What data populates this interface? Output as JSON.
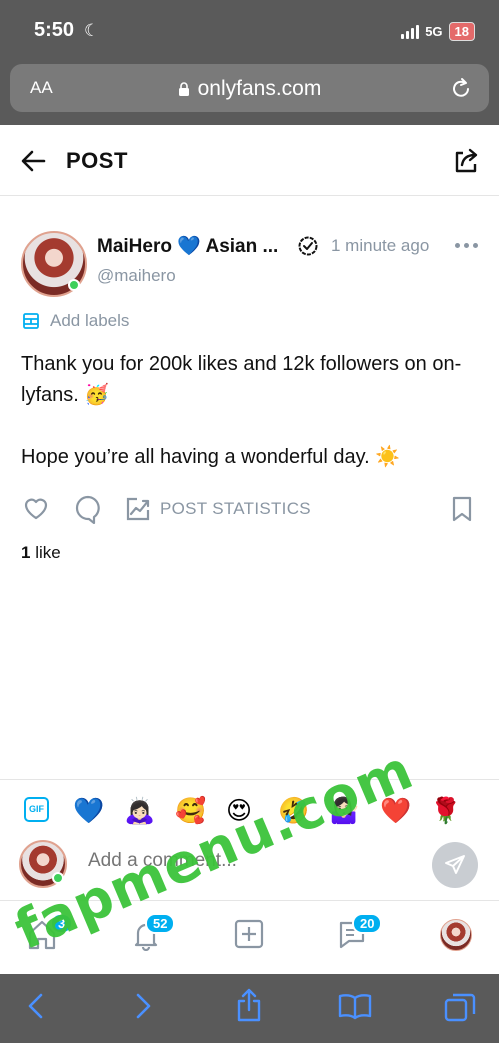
{
  "status_bar": {
    "time": "5:50",
    "network": "5G",
    "battery": "18"
  },
  "browser": {
    "aa_label": "AA",
    "url": "onlyfans.com"
  },
  "header": {
    "title": "POST"
  },
  "post": {
    "author": "MaiHero 💙 Asian ...",
    "handle": "@maihero",
    "timestamp": "1 minute ago",
    "add_labels": "Add labels",
    "text_line1": "Thank you for 200k likes and 12k followers on on-lyfans. 🥳",
    "text_line2": "Hope you’re all having a wonderful day. ☀️",
    "stats_label": "POST STATISTICS",
    "likes_count": "1",
    "likes_word": " like"
  },
  "composer": {
    "gif_label": "GIF",
    "emojis": [
      "💙",
      "🙇🏻‍♀️",
      "🥰",
      "😍",
      "🤣",
      "🤷🏻‍♀️",
      "❤️",
      "🌹"
    ],
    "placeholder": "Add a comment..."
  },
  "bottom_nav": {
    "home_badge": "3",
    "notifications_badge": "52",
    "messages_badge": "20"
  },
  "watermark": "fapmenu.com",
  "colors": {
    "accent": "#00aff0",
    "muted": "#8a96a3",
    "online": "#3ecf5a",
    "chrome": "#5a5a5a"
  }
}
